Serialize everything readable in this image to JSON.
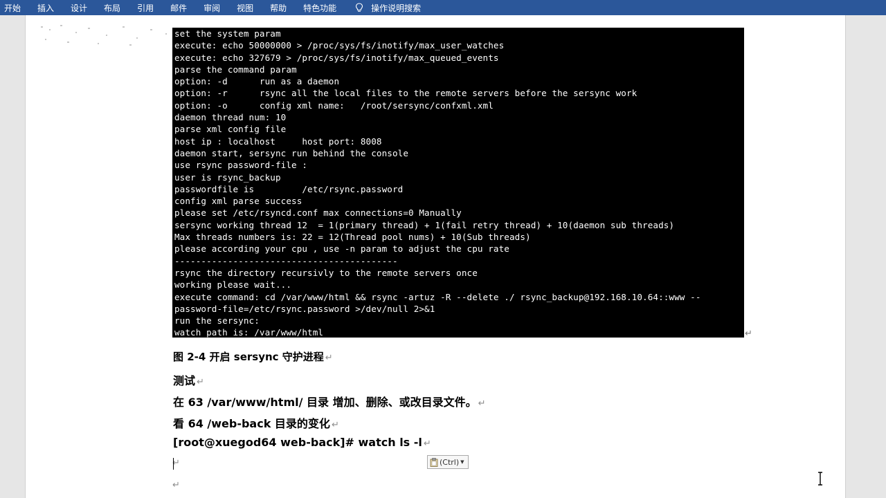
{
  "ribbon": {
    "tabs": [
      "开始",
      "插入",
      "设计",
      "布局",
      "引用",
      "邮件",
      "审阅",
      "视图",
      "帮助",
      "特色功能"
    ],
    "tell_me": "操作说明搜索",
    "color": "#2b579a"
  },
  "terminal": {
    "lines": [
      "set the system param",
      "execute: echo 50000000 > /proc/sys/fs/inotify/max_user_watches",
      "execute: echo 327679 > /proc/sys/fs/inotify/max_queued_events",
      "parse the command param",
      "option: -d      run as a daemon",
      "option: -r      rsync all the local files to the remote servers before the sersync work",
      "option: -o      config xml name:   /root/sersync/confxml.xml",
      "daemon thread num: 10",
      "parse xml config file",
      "host ip : localhost     host port: 8008",
      "daemon start, sersync run behind the console",
      "use rsync password-file :",
      "user is rsync_backup",
      "passwordfile is         /etc/rsync.password",
      "config xml parse success",
      "please set /etc/rsyncd.conf max connections=0 Manually",
      "sersync working thread 12  = 1(primary thread) + 1(fail retry thread) + 10(daemon sub threads)",
      "Max threads numbers is: 22 = 12(Thread pool nums) + 10(Sub threads)",
      "please according your cpu , use -n param to adjust the cpu rate",
      "------------------------------------------",
      "rsync the directory recursivly to the remote servers once",
      "working please wait...",
      "execute command: cd /var/www/html && rsync -artuz -R --delete ./ rsync_backup@192.168.10.64::www --",
      "password-file=/etc/rsync.password >/dev/null 2>&1",
      "run the sersync:",
      "watch path is: /var/www/html"
    ]
  },
  "document": {
    "caption": "图  2-4  开启 sersync 守护进程",
    "heading_test": "测试",
    "step1": "在 63 /var/www/html/  目录  增加、删除、或改目录文件。",
    "step2": "看 64 /web-back  目录的变化",
    "command": "[root@xuegod64 web-back]# watch ls -l",
    "paragraph_mark": "↵"
  },
  "paste_options": {
    "label": "(Ctrl)"
  }
}
